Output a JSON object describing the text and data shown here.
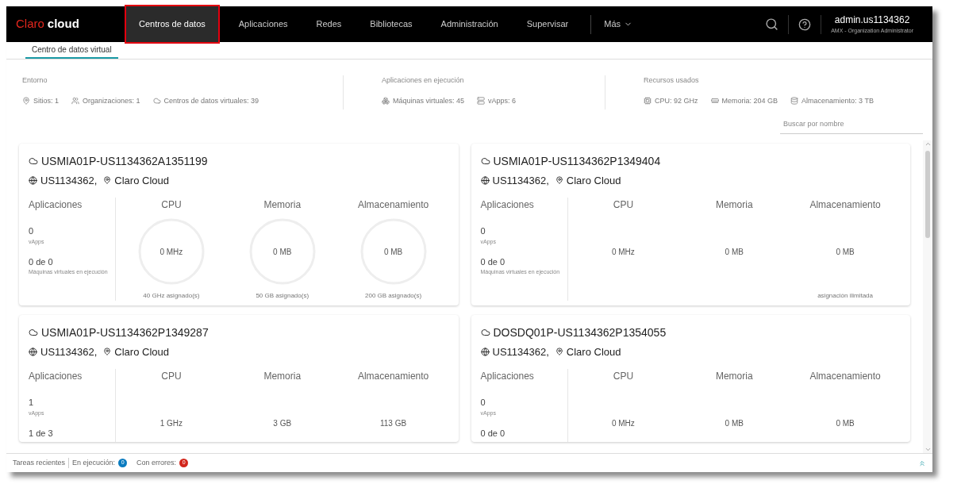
{
  "brand": {
    "red": "Claro",
    "white": "cloud"
  },
  "nav": [
    {
      "label": "Centros de datos",
      "selected": true
    },
    {
      "label": "Aplicaciones",
      "selected": false
    },
    {
      "label": "Redes",
      "selected": false
    },
    {
      "label": "Bibliotecas",
      "selected": false
    },
    {
      "label": "Administración",
      "selected": false
    },
    {
      "label": "Supervisar",
      "selected": false
    }
  ],
  "more": "Más",
  "user": {
    "name": "admin.us1134362",
    "role": "AMX - Organization Administrator"
  },
  "subtabs": [
    {
      "label": "Centro de datos virtual",
      "selected": true
    }
  ],
  "summary": [
    {
      "title": "Entorno",
      "items": [
        "Sitios: 1",
        "Organizaciones: 1",
        "Centros de datos virtuales: 39"
      ]
    },
    {
      "title": "Aplicaciones en ejecución",
      "items": [
        "Máquinas virtuales: 45",
        "vApps: 6"
      ]
    },
    {
      "title": "Recursos usados",
      "items": [
        "CPU: 92 GHz",
        "Memoria: 204 GB",
        "Almacenamiento: 3 TB"
      ]
    }
  ],
  "search": {
    "placeholder": "Buscar por nombre"
  },
  "cards": [
    {
      "name": "USMIA01P-US1134362A1351199",
      "org": "US1134362,",
      "site": "Claro Cloud",
      "apps": {
        "label": "Aplicaciones",
        "vapps": "0",
        "vapps_label": "vApps",
        "vms": "0 de 0",
        "vms_label": "Máquinas virtuales en ejecución"
      },
      "resources": [
        {
          "kind": "gauge",
          "label": "CPU",
          "value": "0 MHz",
          "allocated": "40 GHz asignado(s)"
        },
        {
          "kind": "gauge",
          "label": "Memoria",
          "value": "0 MB",
          "allocated": "50 GB asignado(s)"
        },
        {
          "kind": "gauge",
          "label": "Almacenamiento",
          "value": "0 MB",
          "allocated": "200 GB asignado(s)"
        }
      ]
    },
    {
      "name": "USMIA01P-US1134362P1349404",
      "org": "US1134362,",
      "site": "Claro Cloud",
      "apps": {
        "label": "Aplicaciones",
        "vapps": "0",
        "vapps_label": "vApps",
        "vms": "0 de 0",
        "vms_label": "Máquinas virtuales en ejecución"
      },
      "resources": [
        {
          "label": "CPU",
          "value": "0 MHz"
        },
        {
          "label": "Memoria",
          "value": "0 MB"
        },
        {
          "label": "Almacenamiento",
          "value": "0 MB",
          "allocated": "asignación ilimitada"
        }
      ]
    },
    {
      "name": "USMIA01P-US1134362P1349287",
      "org": "US1134362,",
      "site": "Claro Cloud",
      "apps": {
        "label": "Aplicaciones",
        "vapps": "1",
        "vapps_label": "vApps",
        "vms": "1 de 3"
      },
      "resources": [
        {
          "label": "CPU",
          "value": "1 GHz"
        },
        {
          "label": "Memoria",
          "value": "3 GB"
        },
        {
          "label": "Almacenamiento",
          "value": "113 GB"
        }
      ]
    },
    {
      "name": "DOSDQ01P-US1134362P1354055",
      "org": "US1134362,",
      "site": "Claro Cloud",
      "apps": {
        "label": "Aplicaciones",
        "vapps": "0",
        "vapps_label": "vApps",
        "vms": "0 de 0"
      },
      "resources": [
        {
          "label": "CPU",
          "value": "0 MHz"
        },
        {
          "label": "Memoria",
          "value": "0 MB"
        },
        {
          "label": "Almacenamiento",
          "value": "0 MB"
        }
      ]
    }
  ],
  "status": {
    "recent": "Tareas recientes",
    "running": "En ejecución:",
    "running_count": "0",
    "errors": "Con errores:",
    "errors_count": "0"
  }
}
